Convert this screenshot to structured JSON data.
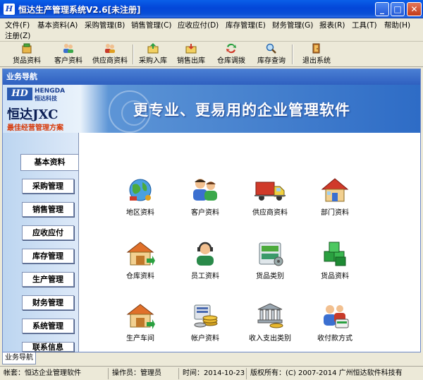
{
  "window": {
    "title": "恒达生产管理系统V2.6[未注册]",
    "icon_letters": "H",
    "min_glyph": "_",
    "max_glyph": "□",
    "close_glyph": "✕"
  },
  "menubar": [
    {
      "label": "文件(F)"
    },
    {
      "label": "基本资料(A)"
    },
    {
      "label": "采购管理(B)"
    },
    {
      "label": "销售管理(C)"
    },
    {
      "label": "应收应付(D)"
    },
    {
      "label": "库存管理(E)"
    },
    {
      "label": "财务管理(G)"
    },
    {
      "label": "报表(R)"
    },
    {
      "label": "工具(T)"
    },
    {
      "label": "帮助(H)"
    },
    {
      "label": "注册(Z)"
    }
  ],
  "toolbar": [
    {
      "label": "货品资料",
      "icon": "goods-icon"
    },
    {
      "label": "客户资料",
      "icon": "customers-icon"
    },
    {
      "label": "供应商资料",
      "icon": "supplier-icon"
    },
    {
      "label": "采购入库",
      "icon": "purchase-in-icon"
    },
    {
      "label": "销售出库",
      "icon": "sales-out-icon"
    },
    {
      "label": "仓库调拨",
      "icon": "transfer-icon"
    },
    {
      "label": "库存查询",
      "icon": "stock-query-icon"
    },
    {
      "label": "退出系统",
      "icon": "exit-icon"
    }
  ],
  "panel": {
    "title": "业务导航"
  },
  "banner": {
    "logo_letters": "HD",
    "logo_en": "HENGDA",
    "logo_cn": "恒达科技",
    "brand": "恒达JXC",
    "tagline": "最佳经营管理方案",
    "slogan": "更专业、更易用的企业管理软件"
  },
  "sidenav": [
    {
      "label": "基本资料",
      "active": true
    },
    {
      "label": "采购管理"
    },
    {
      "label": "销售管理"
    },
    {
      "label": "应收应付"
    },
    {
      "label": "库存管理"
    },
    {
      "label": "生产管理"
    },
    {
      "label": "财务管理"
    },
    {
      "label": "系统管理"
    },
    {
      "label": "联系信息"
    }
  ],
  "modules": [
    {
      "label": "地区资料",
      "icon": "globe-icon"
    },
    {
      "label": "客户资料",
      "icon": "customers-icon"
    },
    {
      "label": "供应商资料",
      "icon": "truck-icon"
    },
    {
      "label": "部门资料",
      "icon": "house-icon"
    },
    {
      "label": "仓库资料",
      "icon": "warehouse-icon"
    },
    {
      "label": "员工资料",
      "icon": "employee-headset-icon"
    },
    {
      "label": "货品类别",
      "icon": "goods-category-icon"
    },
    {
      "label": "货品资料",
      "icon": "goods-cubes-icon"
    },
    {
      "label": "生产车间",
      "icon": "workshop-icon"
    },
    {
      "label": "帐户资料",
      "icon": "coins-icon"
    },
    {
      "label": "收入支出类别",
      "icon": "bank-icon"
    },
    {
      "label": "收付款方式",
      "icon": "payment-method-icon"
    }
  ],
  "bottom_tab": {
    "label": "业务导航"
  },
  "status": {
    "account": "帐套：恒达企业管理软件",
    "operator": "操作员：管理员",
    "date": "时间：2014-10-23",
    "copyright": "版权所有：(C) 2007-2014 广州恒达软件科技有"
  },
  "colors": {
    "titlebar": "#0346d8",
    "panel_header": "#2f60c0",
    "slogan": "#ffffff",
    "tagline": "#d73a0a"
  }
}
